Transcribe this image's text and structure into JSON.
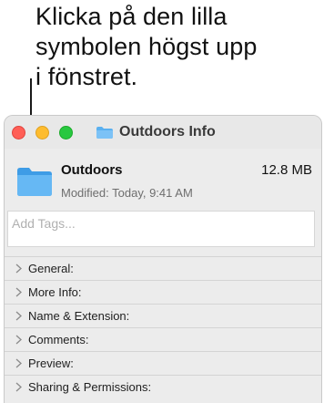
{
  "callout": {
    "line1": "Klicka på den lilla",
    "line2": "symbolen högst upp",
    "line3": "i fönstret."
  },
  "window": {
    "title": "Outdoors Info",
    "item_name": "Outdoors",
    "item_size": "12.8 MB",
    "modified": "Modified: Today, 9:41 AM",
    "tags_placeholder": "Add Tags...",
    "sections": [
      {
        "label": "General:"
      },
      {
        "label": "More Info:"
      },
      {
        "label": "Name & Extension:"
      },
      {
        "label": "Comments:"
      },
      {
        "label": "Preview:"
      },
      {
        "label": "Sharing & Permissions:"
      }
    ]
  },
  "colors": {
    "folder_blue": "#5ab0f0",
    "close": "#ff5f57",
    "minimize": "#febc2e",
    "zoom": "#28c840"
  },
  "icons": {
    "title_icon": "folder-icon",
    "item_icon": "folder-icon",
    "section_icon": "chevron-right-icon"
  }
}
